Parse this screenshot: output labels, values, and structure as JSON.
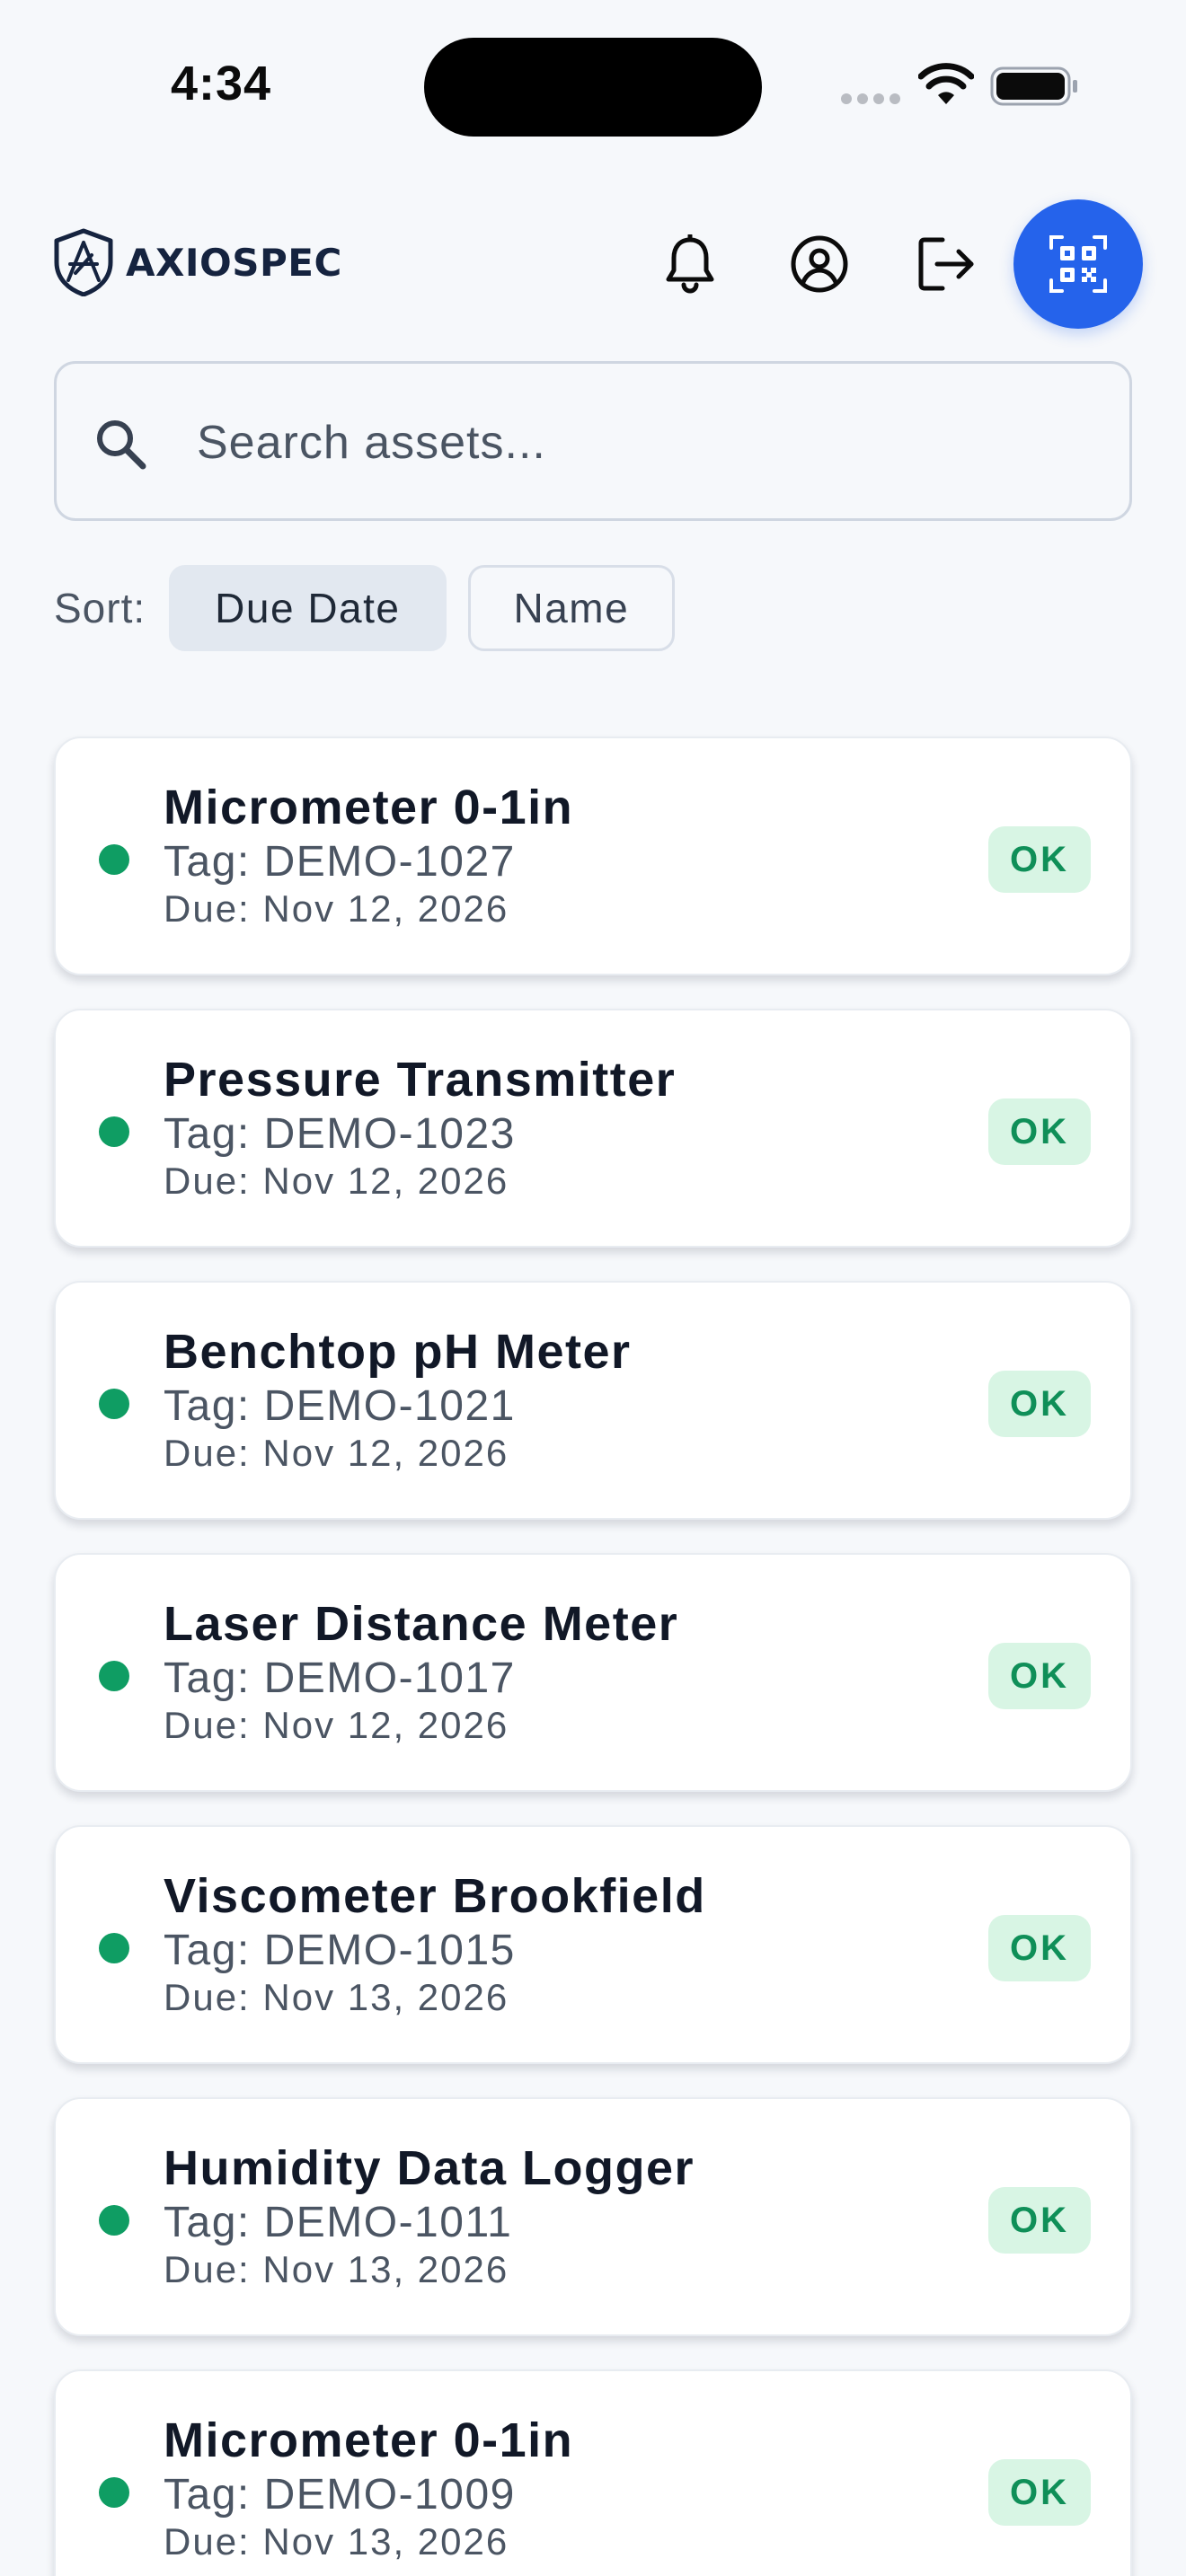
{
  "status_bar": {
    "time": "4:34"
  },
  "header": {
    "brand": "AXIOSPEC",
    "icons": {
      "notifications": "bell-icon",
      "profile": "user-circle-icon",
      "logout": "logout-icon",
      "scan": "qr-code-icon"
    },
    "accent_color": "#2563eb"
  },
  "search": {
    "placeholder": "Search assets...",
    "value": ""
  },
  "sort": {
    "label": "Sort:",
    "options": [
      {
        "label": "Due Date",
        "selected": true
      },
      {
        "label": "Name",
        "selected": false
      }
    ]
  },
  "assets": [
    {
      "name": "Micrometer 0-1in",
      "tag": "Tag: DEMO-1027",
      "due": "Due: Nov 12, 2026",
      "status": "OK"
    },
    {
      "name": "Pressure Transmitter",
      "tag": "Tag: DEMO-1023",
      "due": "Due: Nov 12, 2026",
      "status": "OK"
    },
    {
      "name": "Benchtop pH Meter",
      "tag": "Tag: DEMO-1021",
      "due": "Due: Nov 12, 2026",
      "status": "OK"
    },
    {
      "name": "Laser Distance Meter",
      "tag": "Tag: DEMO-1017",
      "due": "Due: Nov 12, 2026",
      "status": "OK"
    },
    {
      "name": "Viscometer Brookfield",
      "tag": "Tag: DEMO-1015",
      "due": "Due: Nov 13, 2026",
      "status": "OK"
    },
    {
      "name": "Humidity Data Logger",
      "tag": "Tag: DEMO-1011",
      "due": "Due: Nov 13, 2026",
      "status": "OK"
    },
    {
      "name": "Micrometer 0-1in",
      "tag": "Tag: DEMO-1009",
      "due": "Due: Nov 13, 2026",
      "status": "OK"
    }
  ],
  "colors": {
    "status_ok_dot": "#0f9d63",
    "status_ok_badge_bg": "#d8f5e4",
    "status_ok_badge_text": "#0f8f58"
  }
}
